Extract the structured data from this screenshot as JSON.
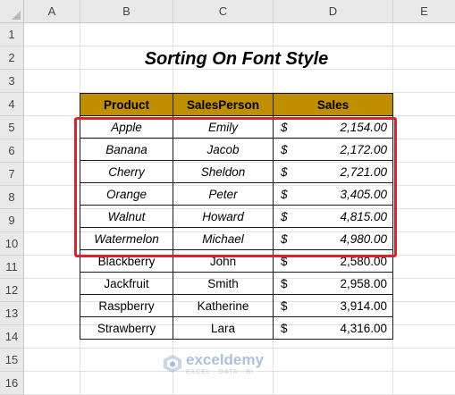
{
  "columns": [
    "A",
    "B",
    "C",
    "D",
    "E"
  ],
  "rows": [
    "1",
    "2",
    "3",
    "4",
    "5",
    "6",
    "7",
    "8",
    "9",
    "10",
    "11",
    "12",
    "13",
    "14",
    "15",
    "16"
  ],
  "title": "Sorting On Font Style",
  "table": {
    "headers": [
      "Product",
      "SalesPerson",
      "Sales"
    ],
    "currency_symbol": "$",
    "records": [
      {
        "product": "Apple",
        "person": "Emily",
        "sales": "2,154.00",
        "italic": true
      },
      {
        "product": "Banana",
        "person": "Jacob",
        "sales": "2,172.00",
        "italic": true
      },
      {
        "product": "Cherry",
        "person": "Sheldon",
        "sales": "2,721.00",
        "italic": true
      },
      {
        "product": "Orange",
        "person": "Peter",
        "sales": "3,405.00",
        "italic": true
      },
      {
        "product": "Walnut",
        "person": "Howard",
        "sales": "4,815.00",
        "italic": true
      },
      {
        "product": "Watermelon",
        "person": "Michael",
        "sales": "4,980.00",
        "italic": true
      },
      {
        "product": "Blackberry",
        "person": "John",
        "sales": "2,580.00",
        "italic": false
      },
      {
        "product": "Jackfruit",
        "person": "Smith",
        "sales": "2,958.00",
        "italic": false
      },
      {
        "product": "Raspberry",
        "person": "Katherine",
        "sales": "3,914.00",
        "italic": false
      },
      {
        "product": "Strawberry",
        "person": "Lara",
        "sales": "4,316.00",
        "italic": false
      }
    ]
  },
  "watermark": {
    "name": "exceldemy",
    "tagline": "EXCEL · DATA · BI"
  },
  "colors": {
    "header_fill": "#bf8f00",
    "highlight_border": "#e0202a",
    "grid": "#e1e1e1"
  }
}
